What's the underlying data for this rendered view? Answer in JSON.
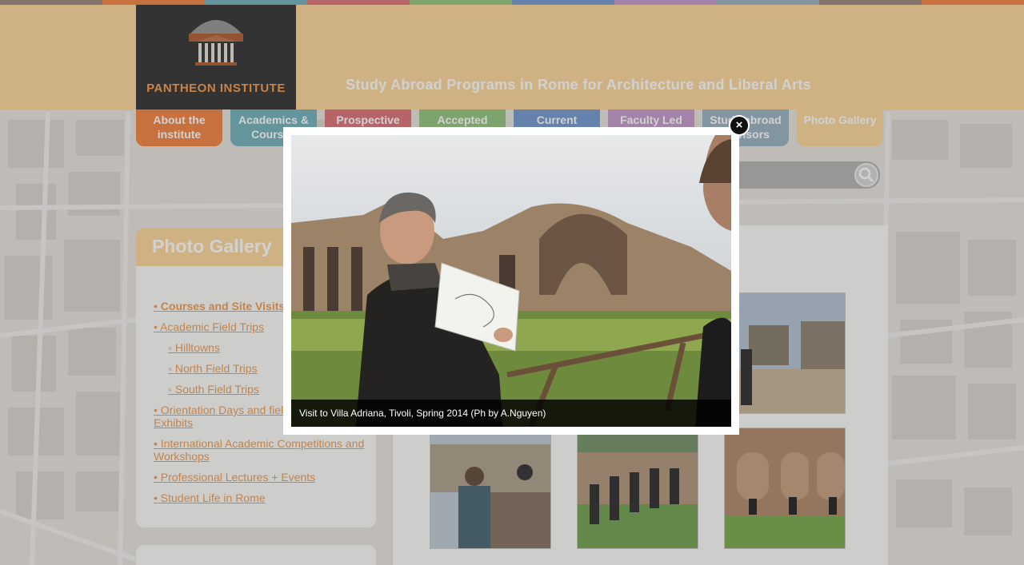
{
  "colors": {
    "header": "#fcd9a1",
    "logo_box": "#3f3f3f",
    "logo_text": "#f4a055",
    "link": "#f0a25a",
    "tab_about": "#f28a4c",
    "tab_academics": "#7ab6c0",
    "tab_prospective": "#e07b80",
    "tab_accepted": "#9ac987",
    "tab_current": "#7b9fd2",
    "tab_faculty": "#c9a0cf",
    "tab_study": "#9fb7c5",
    "tab_gallery": "#fcd9a1"
  },
  "header": {
    "logo_icon": "pantheon-icon",
    "logo_text": "PANTHEON INSTITUTE",
    "tagline": "Study Abroad Programs in Rome for Architecture and Liberal Arts"
  },
  "nav": {
    "tabs": [
      {
        "line1": "About the",
        "line2": "institute"
      },
      {
        "line1": "Academics &",
        "line2": "Courses"
      },
      {
        "line1": "Prospective",
        "line2": ""
      },
      {
        "line1": "Accepted",
        "line2": ""
      },
      {
        "line1": "Current",
        "line2": ""
      },
      {
        "line1": "Faculty Led",
        "line2": ""
      },
      {
        "line1": "Study abroad",
        "line2": "Advisors"
      },
      {
        "line1": "Photo Gallery",
        "line2": ""
      }
    ]
  },
  "search": {
    "icon": "magnifier-icon"
  },
  "sidebar": {
    "title": "Photo Gallery",
    "links": [
      "Courses and Site Visits",
      "Academic Field Trips",
      "Hilltowns",
      "North Field Trips",
      "South Field Trips",
      "Orientation Days and field",
      "Exhibits",
      "International Academic Competitions and",
      "Workshops",
      "Professional Lectures + Events",
      "Student Life in Rome"
    ]
  },
  "lightbox": {
    "caption": "Visit to Villa Adriana, Tivoli, Spring 2014 (Ph by A.Nguyen)",
    "close_icon": "close-icon",
    "close_glyph": "×"
  }
}
